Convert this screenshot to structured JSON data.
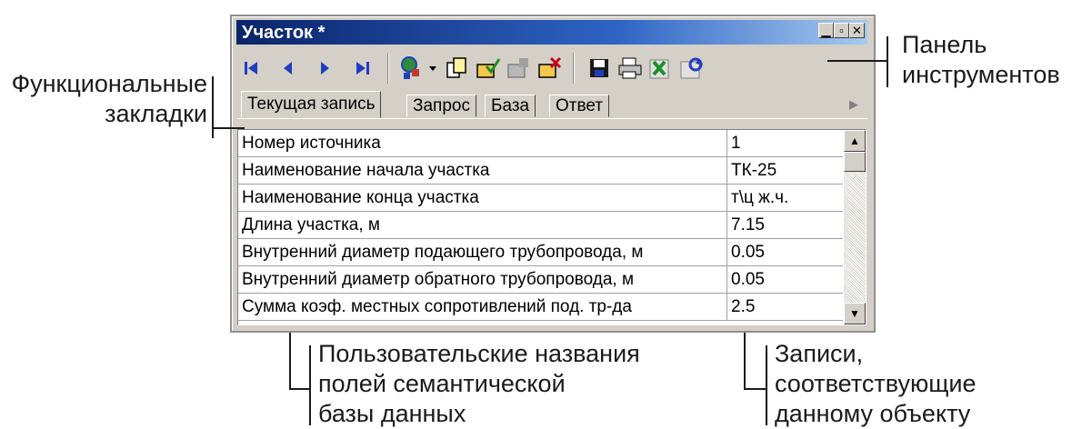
{
  "window": {
    "title": "Участок *",
    "controls": [
      "minimize-icon",
      "maximize-icon",
      "close-icon"
    ]
  },
  "toolbar": {
    "buttons": [
      "first-record-icon",
      "prev-record-icon",
      "next-record-icon",
      "last-record-icon",
      "object-binding-icon",
      "dropdown-arrow-icon",
      "copy-record-icon",
      "edit-record-icon",
      "new-record-icon",
      "delete-record-icon",
      "save-icon",
      "print-icon",
      "export-excel-icon",
      "refresh-icon"
    ]
  },
  "tabs": [
    {
      "label": "Текущая запись",
      "active": true
    },
    {
      "label": "Запрос",
      "active": false
    },
    {
      "label": "База",
      "active": false
    },
    {
      "label": "Ответ",
      "active": false
    }
  ],
  "table": {
    "rows": [
      {
        "name": "Номер источника",
        "value": "1"
      },
      {
        "name": "Наименование начала участка",
        "value": "ТК-25"
      },
      {
        "name": "Наименование конца участка",
        "value": "т\\ц ж.ч."
      },
      {
        "name": "Длина участка, м",
        "value": "7.15"
      },
      {
        "name": "Внутренний диаметр подающего трубопровода, м",
        "value": "0.05"
      },
      {
        "name": "Внутренний диаметр обратного трубопровода, м",
        "value": "0.05"
      },
      {
        "name": "Сумма коэф. местных сопротивлений под. тр-да",
        "value": "2.5"
      }
    ]
  },
  "annotations": {
    "toolbar_panel": [
      "Панель",
      "инструментов"
    ],
    "functional_tabs": [
      "Функциональные",
      "закладки"
    ],
    "field_names": [
      "Пользовательские названия",
      "полей семантической",
      "базы данных"
    ],
    "records": [
      "Записи,",
      "соответствующие",
      "данному объекту"
    ]
  },
  "colors": {
    "titlebar": "#0a246a",
    "window_bg": "#d4d0c8",
    "toolbar_blue": "#1f3fbf"
  }
}
